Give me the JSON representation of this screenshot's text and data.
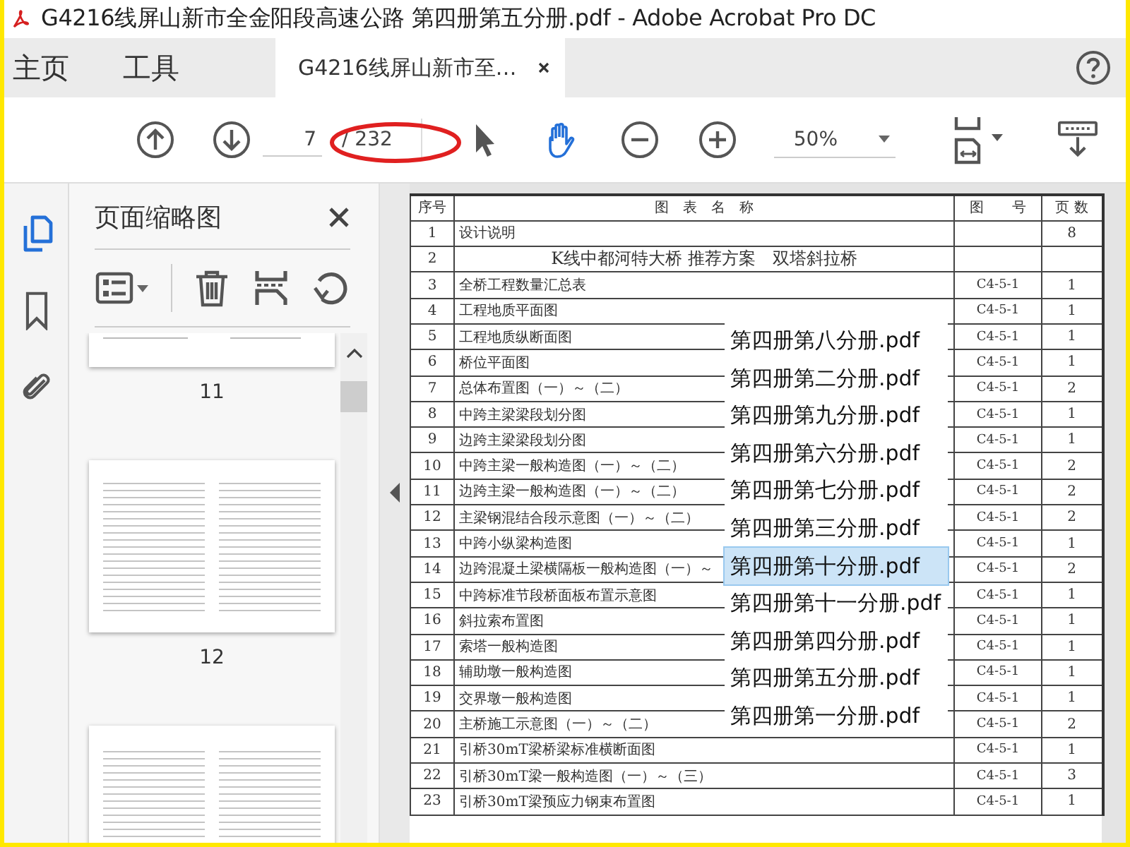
{
  "window": {
    "title": "G4216线屏山新市全金阳段高速公路 第四册第五分册.pdf - Adobe Acrobat Pro DC"
  },
  "tabs": [
    {
      "label": "主页",
      "selected": false,
      "kind": "nav"
    },
    {
      "label": "工具",
      "selected": false,
      "kind": "nav"
    },
    {
      "label": "G4216线屏山新市至…",
      "selected": true,
      "kind": "document"
    }
  ],
  "toolbar": {
    "page_number": "7",
    "page_count": "/ 232",
    "zoom": "50%",
    "tools": [
      {
        "kind": "select",
        "selected": false
      },
      {
        "kind": "hand",
        "selected": true
      }
    ]
  },
  "sidebar": {
    "title": "页面缩略图",
    "thumbnail_labels": [
      "11",
      "12"
    ]
  },
  "table": {
    "columns": [
      "序号",
      "图　表　名　称",
      "图　　号",
      "页 数"
    ],
    "rows": [
      {
        "kind": "item",
        "no": "1",
        "name": "设计说明",
        "pages": "8"
      },
      {
        "kind": "section",
        "no": "2",
        "name": "K线中都河特大桥 推荐方案　双塔斜拉桥"
      },
      {
        "kind": "item",
        "no": "3",
        "name": "全桥工程数量汇总表",
        "drawing_no": "C4-5-1",
        "pages": "1"
      },
      {
        "kind": "item",
        "no": "4",
        "name": "工程地质平面图",
        "drawing_no": "C4-5-1",
        "pages": "1"
      },
      {
        "kind": "item",
        "no": "5",
        "name": "工程地质纵断面图",
        "drawing_no": "C4-5-1",
        "pages": "1"
      },
      {
        "kind": "item",
        "no": "6",
        "name": "桥位平面图",
        "drawing_no": "C4-5-1",
        "pages": "1"
      },
      {
        "kind": "item",
        "no": "7",
        "name": "总体布置图（一）～（二）",
        "drawing_no": "C4-5-1",
        "pages": "2"
      },
      {
        "kind": "item",
        "no": "8",
        "name": "中跨主梁梁段划分图",
        "drawing_no": "C4-5-1",
        "pages": "1"
      },
      {
        "kind": "item",
        "no": "9",
        "name": "边跨主梁梁段划分图",
        "drawing_no": "C4-5-1",
        "pages": "1"
      },
      {
        "kind": "item",
        "no": "10",
        "name": "中跨主梁一般构造图（一）～（二）",
        "drawing_no": "C4-5-1",
        "pages": "2"
      },
      {
        "kind": "item",
        "no": "11",
        "name": "边跨主梁一般构造图（一）～（二）",
        "drawing_no": "C4-5-1",
        "pages": "2"
      },
      {
        "kind": "item",
        "no": "12",
        "name": "主梁钢混结合段示意图（一）～（二）",
        "drawing_no": "C4-5-1",
        "pages": "2"
      },
      {
        "kind": "item",
        "no": "13",
        "name": "中跨小纵梁构造图",
        "drawing_no": "C4-5-1",
        "pages": "1"
      },
      {
        "kind": "item",
        "no": "14",
        "name": "边跨混凝土梁横隔板一般构造图（一）～",
        "drawing_no": "C4-5-1",
        "pages": "2"
      },
      {
        "kind": "item",
        "no": "15",
        "name": "中跨标准节段桥面板布置示意图",
        "drawing_no": "C4-5-1",
        "pages": "1"
      },
      {
        "kind": "item",
        "no": "16",
        "name": "斜拉索布置图",
        "drawing_no": "C4-5-1",
        "pages": "1"
      },
      {
        "kind": "item",
        "no": "17",
        "name": "索塔一般构造图",
        "drawing_no": "C4-5-1",
        "pages": "1"
      },
      {
        "kind": "item",
        "no": "18",
        "name": "辅助墩一般构造图",
        "drawing_no": "C4-5-1",
        "pages": "1"
      },
      {
        "kind": "item",
        "no": "19",
        "name": "交界墩一般构造图",
        "drawing_no": "C4-5-1",
        "pages": "1"
      },
      {
        "kind": "item",
        "no": "20",
        "name": "主桥施工示意图（一）～（二）",
        "drawing_no": "C4-5-1",
        "pages": "2"
      },
      {
        "kind": "item",
        "no": "21",
        "name": "引桥30mT梁桥梁标准横断面图",
        "drawing_no": "C4-5-1",
        "pages": "1"
      },
      {
        "kind": "item",
        "no": "22",
        "name": "引桥30mT梁一般构造图（一）～（三）",
        "drawing_no": "C4-5-1",
        "pages": "3"
      },
      {
        "kind": "item",
        "no": "23",
        "name": "引桥30mT梁预应力钢束布置图",
        "drawing_no": "C4-5-1",
        "pages": "1"
      }
    ]
  },
  "file_list": [
    {
      "name": "第四册第八分册.pdf",
      "selected": false
    },
    {
      "name": "第四册第二分册.pdf",
      "selected": false
    },
    {
      "name": "第四册第九分册.pdf",
      "selected": false
    },
    {
      "name": "第四册第六分册.pdf",
      "selected": false
    },
    {
      "name": "第四册第七分册.pdf",
      "selected": false
    },
    {
      "name": "第四册第三分册.pdf",
      "selected": false
    },
    {
      "name": "第四册第十分册.pdf",
      "selected": true
    },
    {
      "name": "第四册第十一分册.pdf",
      "selected": false
    },
    {
      "name": "第四册第四分册.pdf",
      "selected": false
    },
    {
      "name": "第四册第五分册.pdf",
      "selected": false
    },
    {
      "name": "第四册第一分册.pdf",
      "selected": false
    }
  ]
}
